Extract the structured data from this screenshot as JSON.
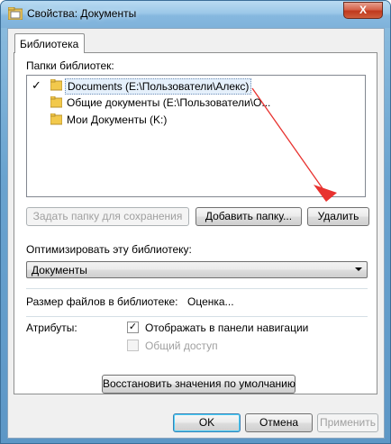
{
  "window": {
    "title": "Свойства: Документы",
    "close_glyph": "X"
  },
  "tab": {
    "label": "Библиотека"
  },
  "library": {
    "folders_label": "Папки библиотек:",
    "folders": [
      {
        "check": "✓",
        "label": "Documents (E:\\Пользователи\\Алекс)",
        "selected": true
      },
      {
        "check": "",
        "label": "Общие документы (E:\\Пользователи\\О...",
        "selected": false
      },
      {
        "check": "",
        "label": "Мои Документы (K:)",
        "selected": false
      }
    ],
    "set_save_folder_button": "Задать папку для сохранения",
    "add_folder_button": "Добавить папку...",
    "remove_button": "Удалить"
  },
  "optimize": {
    "label": "Оптимизировать эту библиотеку:",
    "selected": "Документы"
  },
  "size": {
    "label": "Размер файлов в библиотеке:",
    "value": "Оценка..."
  },
  "attributes": {
    "label": "Атрибуты:",
    "show_in_nav": {
      "label": "Отображать в панели навигации",
      "checked": true,
      "mark": "✓"
    },
    "shared": {
      "label": "Общий доступ",
      "checked": false
    }
  },
  "restore_defaults_button": "Восстановить значения по умолчанию",
  "footer": {
    "ok": "OK",
    "cancel": "Отмена",
    "apply": "Применить"
  },
  "colors": {
    "annotation_arrow": "#e8322f",
    "folder": "#f2c94c"
  }
}
